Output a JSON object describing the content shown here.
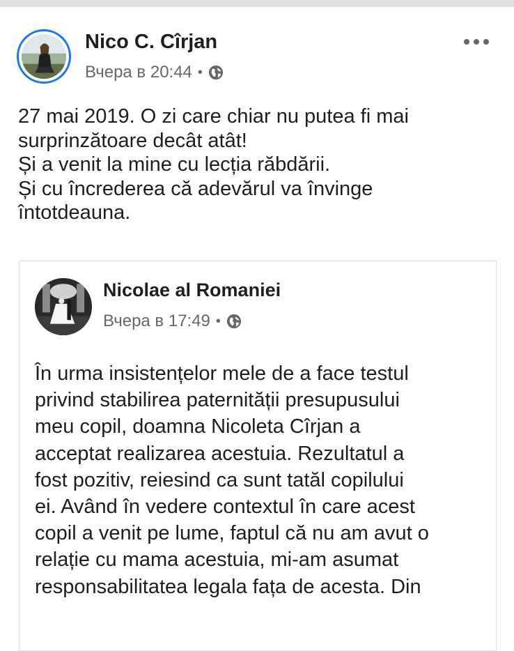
{
  "post": {
    "author": "Nico C. Cîrjan",
    "time": "Вчера в 20:44",
    "separator": "•",
    "privacy_icon": "globe-icon",
    "menu_icon": "more-options-icon",
    "text_lines": [
      "27 mai 2019. O zi care chiar nu putea fi mai",
      "surprinzătoare decât atât!",
      "Și a venit la mine cu lecția răbdării.",
      "Și cu încrederea că adevărul va învinge",
      "întotdeauna."
    ]
  },
  "shared_post": {
    "author": "Nicolae al Romaniei",
    "time": "Вчера в 17:49",
    "separator": "•",
    "privacy_icon": "globe-icon",
    "text_lines": [
      "În urma insistențelor mele de a face testul",
      "privind stabilirea paternității presupusului",
      "meu copil, doamna Nicoleta Cîrjan a",
      "acceptat realizarea acestuia.  Rezultatul a",
      "fost pozitiv, reiesind ca sunt tatăl copilului",
      "ei. Având în vedere contextul în care acest",
      "copil a venit pe lume, faptul că nu am avut o",
      "relație cu mama acestuia, mi-am asumat",
      "responsabilitatea legala fața de acesta. Din"
    ]
  },
  "colors": {
    "accent": "#1877f2",
    "text": "#1c1e21",
    "secondary": "#65676b",
    "border": "#dddfe2"
  }
}
